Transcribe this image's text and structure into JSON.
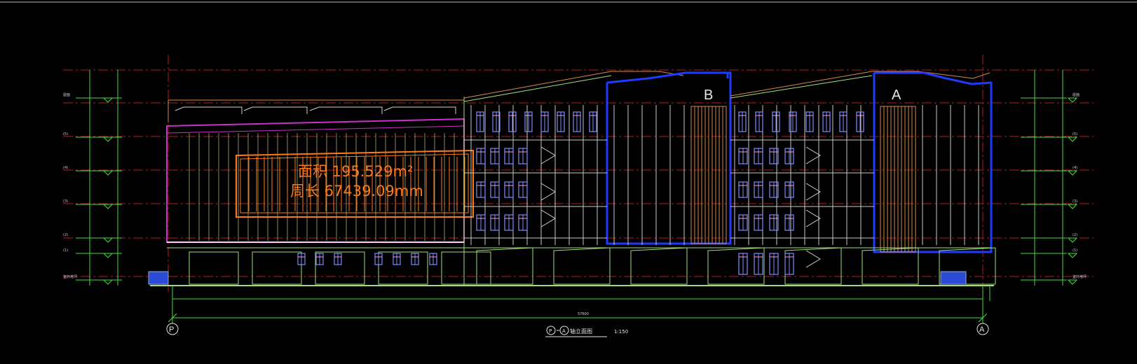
{
  "drawing": {
    "block_labels": [
      "B",
      "A"
    ],
    "area_readout": "面积 195.529m²",
    "perimeter_readout": "周长 67439.09mm",
    "grid_left": "P",
    "grid_right": "A",
    "title": "P - A 轴立面图",
    "title_grid_left": "P",
    "title_grid_right": "A",
    "title_text": "轴立面图",
    "scale": "1:150",
    "overall_length": "57600",
    "left_levels": [
      "屋面",
      "(5)",
      "(4)",
      "(3)",
      "(2)",
      "(1)",
      "室外地坪"
    ],
    "right_levels": [
      "屋面",
      "(5)",
      "(4)",
      "(3)",
      "(2)",
      "(1)",
      "室外地坪"
    ]
  },
  "colors": {
    "background": "#000000",
    "grid_red": "#c41e1e",
    "structure_blue": "#1e3cff",
    "magenta": "#c832c8",
    "orange": "#ff7a1a",
    "facade_green": "#9fe07a",
    "dim_green": "#40e040",
    "white": "#e6e6e6",
    "window_pink": "#ff9ad6"
  }
}
